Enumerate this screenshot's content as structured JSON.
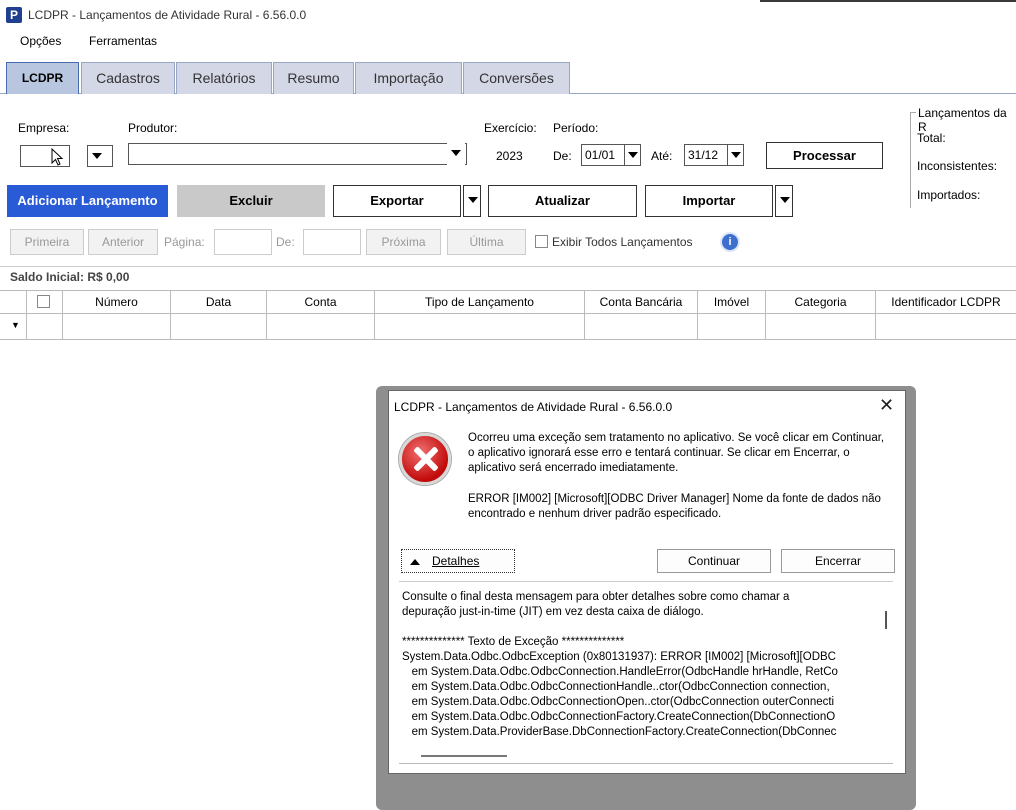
{
  "window": {
    "app_icon_letter": "P",
    "title": "LCDPR - Lançamentos de Atividade Rural - 6.56.0.0"
  },
  "menu": {
    "items": [
      "Opções",
      "Ferramentas"
    ]
  },
  "tabs": [
    "LCDPR",
    "Cadastros",
    "Relatórios",
    "Resumo",
    "Importação",
    "Conversões"
  ],
  "form": {
    "empresa_label": "Empresa:",
    "produtor_label": "Produtor:",
    "exercicio_label": "Exercício:",
    "exercicio_value": "2023",
    "periodo_label": "Período:",
    "de_label": "De:",
    "de_value": "01/01",
    "ate_label": "Até:",
    "ate_value": "31/12",
    "processar_label": "Processar"
  },
  "lancamentos_panel": {
    "title": "Lançamentos da R",
    "total_label": "Total:",
    "inconsistentes_label": "Inconsistentes:",
    "importados_label": "Importados:"
  },
  "toolbar": {
    "adicionar": "Adicionar Lançamento",
    "excluir": "Excluir",
    "exportar": "Exportar",
    "atualizar": "Atualizar",
    "importar": "Importar"
  },
  "pager": {
    "primeira": "Primeira",
    "anterior": "Anterior",
    "pagina_label": "Página:",
    "de_label": "De:",
    "proxima": "Próxima",
    "ultima": "Última",
    "exibir_todos": "Exibir Todos Lançamentos",
    "info_icon": "i"
  },
  "grid": {
    "saldo_inicial": "Saldo Inicial: R$ 0,00",
    "columns": [
      "Número",
      "Data",
      "Conta",
      "Tipo de Lançamento",
      "Conta Bancária",
      "Imóvel",
      "Categoria",
      "Identificador LCDPR"
    ],
    "new_row_marker": "▼"
  },
  "dialog": {
    "title": "LCDPR - Lançamentos de Atividade Rural - 6.56.0.0",
    "close_glyph": "✕",
    "message": "Ocorreu uma exceção sem tratamento no aplicativo. Se você clicar em Continuar, o aplicativo ignorará esse erro e tentará continuar. Se clicar em Encerrar, o aplicativo será encerrado imediatamente.",
    "error_detail": "ERROR [IM002] [Microsoft][ODBC Driver Manager] Nome da fonte de dados não encontrado e nenhum driver padrão especificado.",
    "detalhes_label": "Detalhes",
    "continuar_label": "Continuar",
    "encerrar_label": "Encerrar",
    "details_text": "Consulte o final desta mensagem para obter detalhes sobre como chamar a\ndepuração just-in-time (JIT) em vez desta caixa de diálogo.\n\n************** Texto de Exceção **************\nSystem.Data.Odbc.OdbcException (0x80131937): ERROR [IM002] [Microsoft][ODBC\n   em System.Data.Odbc.OdbcConnection.HandleError(OdbcHandle hrHandle, RetCo\n   em System.Data.Odbc.OdbcConnectionHandle..ctor(OdbcConnection connection,\n   em System.Data.Odbc.OdbcConnectionOpen..ctor(OdbcConnection outerConnecti\n   em System.Data.Odbc.OdbcConnectionFactory.CreateConnection(DbConnectionO\n   em System.Data.ProviderBase.DbConnectionFactory.CreateConnection(DbConnec"
  }
}
